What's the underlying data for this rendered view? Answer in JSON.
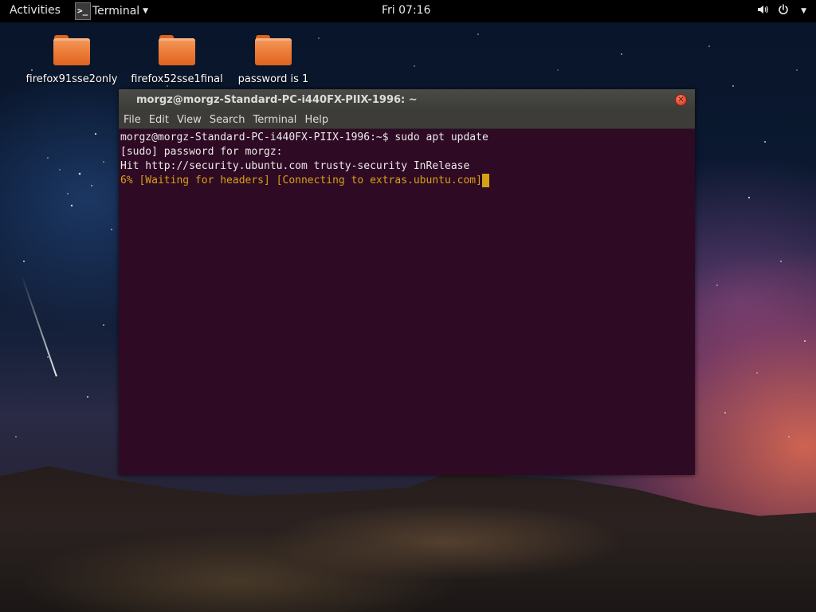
{
  "topbar": {
    "activities": "Activities",
    "app_icon": "terminal-icon",
    "app_name": "Terminal",
    "clock": "Fri 07:16",
    "status_icons": [
      "volume-icon",
      "power-icon"
    ]
  },
  "desktop": {
    "icons": [
      {
        "label": "firefox91sse2only",
        "icon": "folder-icon"
      },
      {
        "label": "firefox52sse1final",
        "icon": "folder-icon"
      },
      {
        "label": "password is 1",
        "icon": "folder-icon"
      }
    ]
  },
  "window": {
    "title": "morgz@morgz-Standard-PC-i440FX-PIIX-1996: ~",
    "menu": [
      "File",
      "Edit",
      "View",
      "Search",
      "Terminal",
      "Help"
    ],
    "terminal_lines": [
      "morgz@morgz-Standard-PC-i440FX-PIIX-1996:~$ sudo apt update",
      "[sudo] password for morgz:",
      "Hit http://security.ubuntu.com trusty-security InRelease",
      "6% [Waiting for headers] [Connecting to extras.ubuntu.com]"
    ],
    "progress_percent": 6
  },
  "colors": {
    "terminal_bg": "#2f0a24",
    "warning_text": "#d6a114",
    "folder": "#ec7a36",
    "topbar": "#000000"
  }
}
